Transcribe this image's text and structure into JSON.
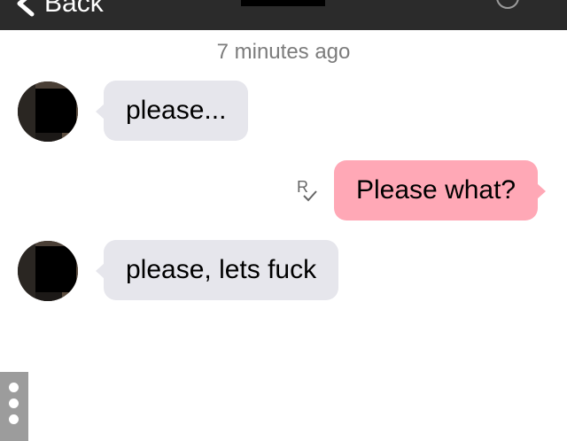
{
  "navbar": {
    "back_label": "Back"
  },
  "conversation": {
    "timestamp": "7 minutes ago",
    "messages": [
      {
        "direction": "incoming",
        "text": "please..."
      },
      {
        "direction": "outgoing",
        "text": "Please what?",
        "receipt_mark": "R"
      },
      {
        "direction": "incoming",
        "text": "please, lets fuck"
      }
    ]
  },
  "colors": {
    "navbar_bg": "#2b2b2b",
    "incoming_bubble": "#e6e6ec",
    "outgoing_bubble": "#ffa8b6",
    "timestamp_text": "#7c7c7c"
  },
  "icons": {
    "back": "chevron-left-icon",
    "nav_right": "circle-icon",
    "receipt": "read-receipt-icon",
    "side_menu": "vertical-dots-icon"
  }
}
